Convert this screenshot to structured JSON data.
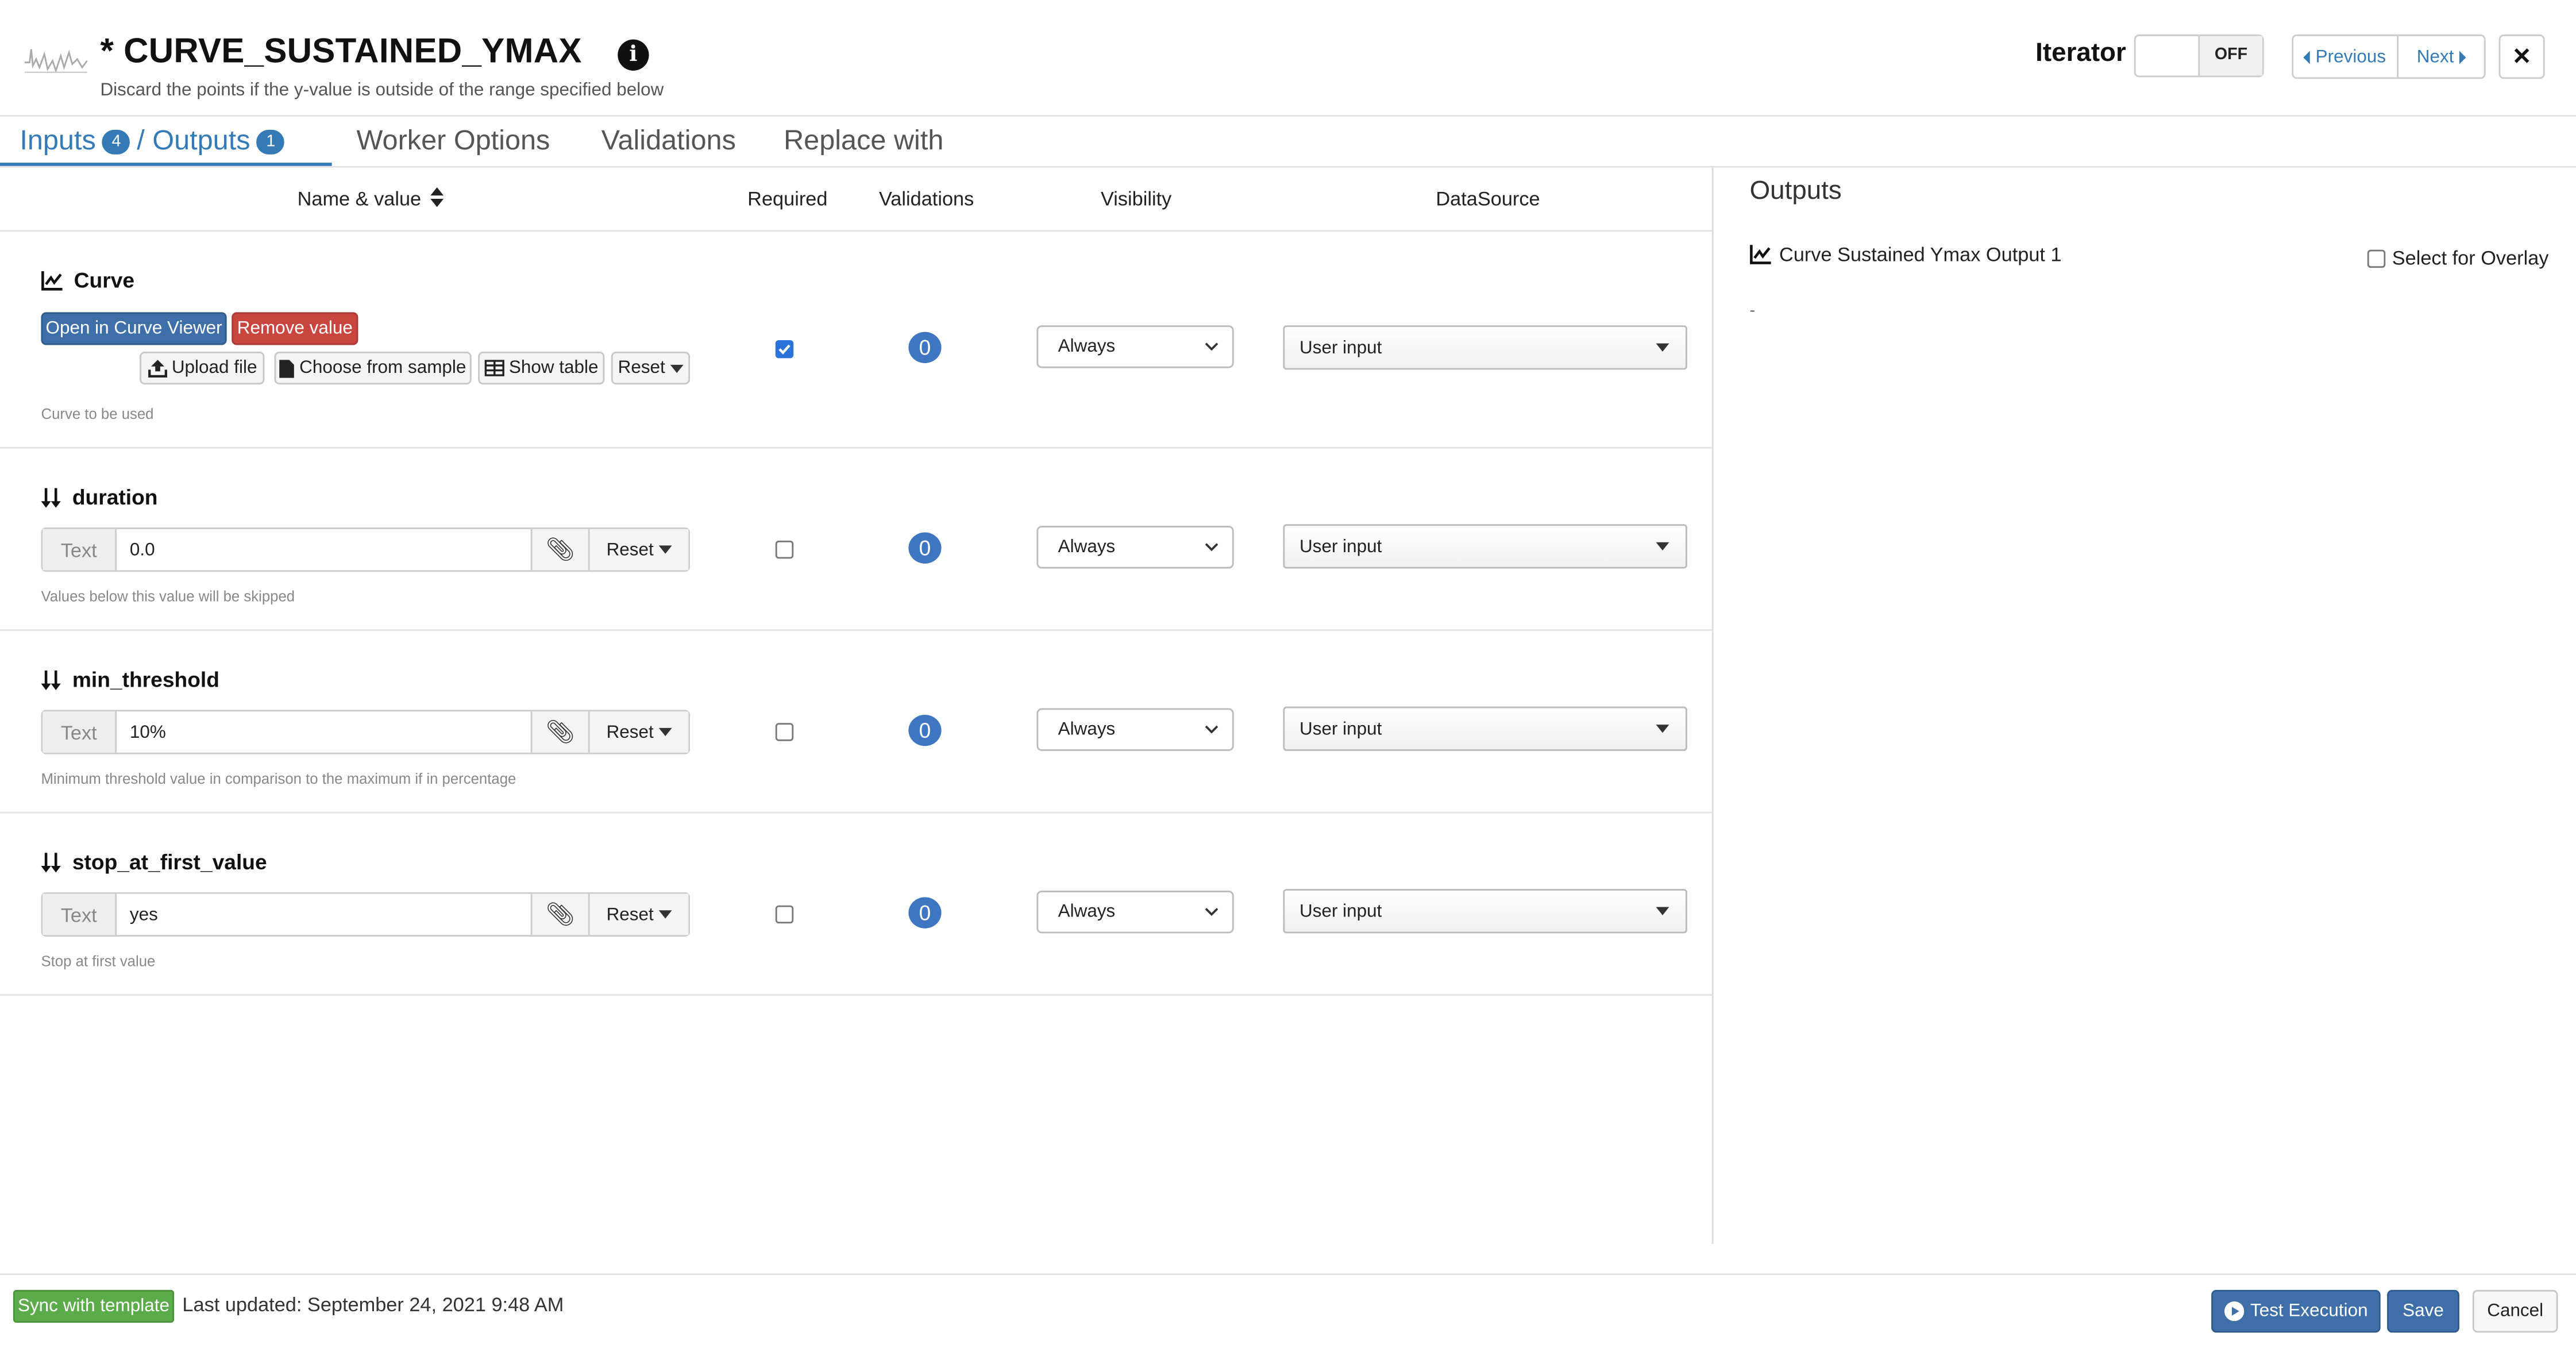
{
  "header": {
    "title": "* CURVE_SUSTAINED_YMAX",
    "subtitle": "Discard the points if the y-value is outside of the range specified below",
    "iterator_label": "Iterator",
    "iterator_state": "OFF",
    "previous_label": "Previous",
    "next_label": "Next"
  },
  "tabs": {
    "inputs_label": "Inputs",
    "inputs_count": "4",
    "outputs_label": "/ Outputs",
    "outputs_count": "1",
    "worker_options": "Worker Options",
    "validations": "Validations",
    "replace_with": "Replace with"
  },
  "columns": {
    "name_value": "Name & value",
    "required": "Required",
    "validations": "Validations",
    "visibility": "Visibility",
    "datasource": "DataSource"
  },
  "curve": {
    "name": "Curve",
    "open_viewer": "Open in Curve Viewer",
    "remove_value": "Remove value",
    "upload_file": "Upload file",
    "choose_sample": "Choose from sample",
    "show_table": "Show table",
    "reset": "Reset",
    "description": "Curve to be used",
    "required": true,
    "validations": "0",
    "visibility": "Always",
    "datasource": "User input"
  },
  "params": [
    {
      "name": "duration",
      "addon": "Text",
      "value": "0.0",
      "reset": "Reset",
      "description": "Values below this value will be skipped",
      "required": false,
      "validations": "0",
      "visibility": "Always",
      "datasource": "User input"
    },
    {
      "name": "min_threshold",
      "addon": "Text",
      "value": "10%",
      "reset": "Reset",
      "description": "Minimum threshold value in comparison to the maximum if in percentage",
      "required": false,
      "validations": "0",
      "visibility": "Always",
      "datasource": "User input"
    },
    {
      "name": "stop_at_first_value",
      "addon": "Text",
      "value": "yes",
      "reset": "Reset",
      "description": "Stop at first value",
      "required": false,
      "validations": "0",
      "visibility": "Always",
      "datasource": "User input"
    }
  ],
  "outputs": {
    "title": "Outputs",
    "item_label": "Curve Sustained Ymax Output 1",
    "overlay_label": "Select for Overlay",
    "placeholder": "-"
  },
  "footer": {
    "sync_label": "Sync with template",
    "last_updated": "Last updated: September 24, 2021 9:48 AM",
    "test_execution": "Test Execution",
    "save": "Save",
    "cancel": "Cancel"
  },
  "colors": {
    "primary": "#337ab7",
    "danger": "#c9463f",
    "success": "#5cab4a",
    "badge": "#3e76c2"
  }
}
